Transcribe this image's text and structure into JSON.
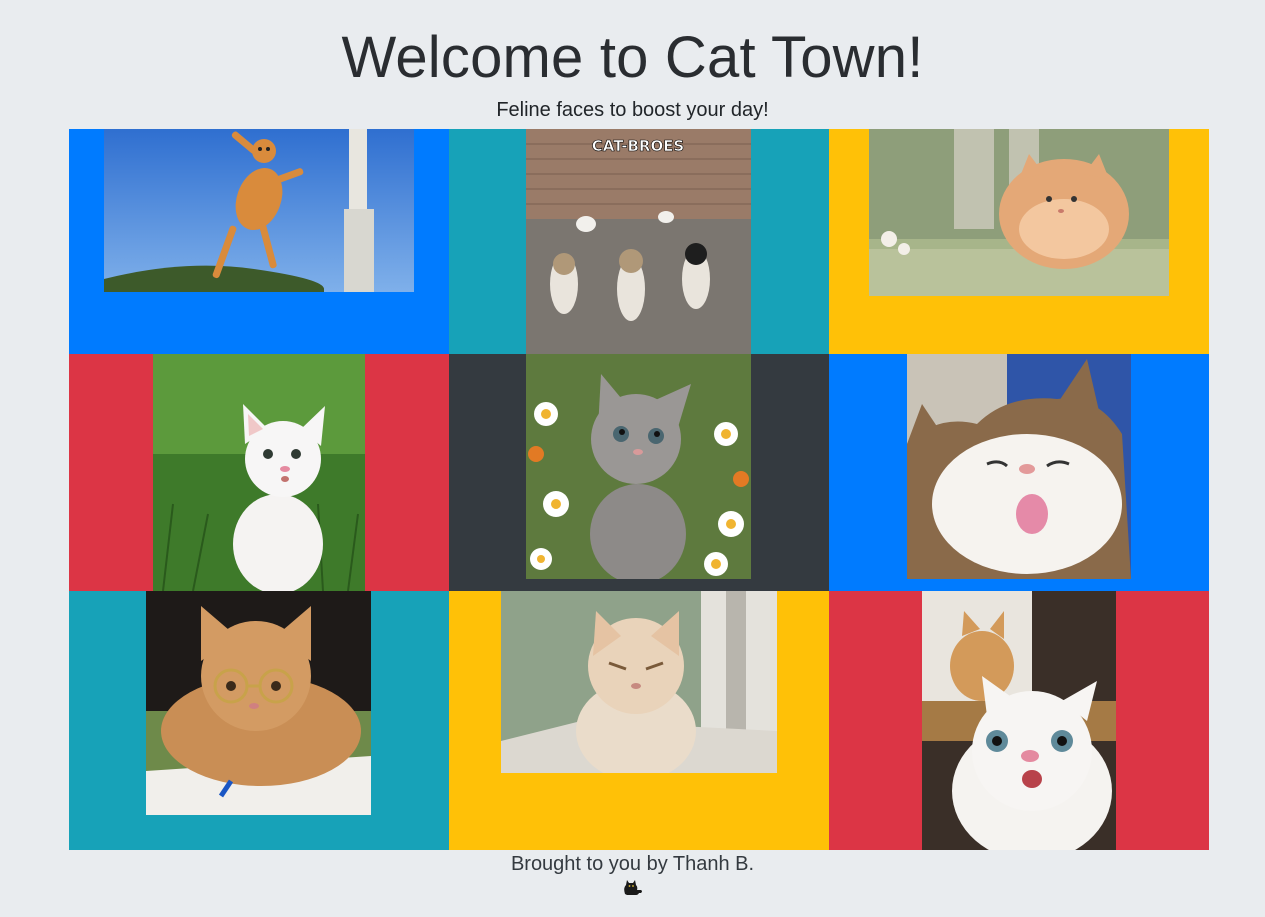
{
  "header": {
    "title": "Welcome to Cat Town!",
    "subtitle": "Feline faces to boost your day!"
  },
  "gallery": {
    "colors": {
      "blue": "#007bff",
      "teal": "#17a2b8",
      "yellow": "#ffc107",
      "red": "#dc3545",
      "dark": "#343a40"
    },
    "tiles": [
      {
        "background": "#007bff",
        "photo": "leaping orange cat against blue sky"
      },
      {
        "background": "#17a2b8",
        "photo": "three cats walking on a street",
        "caption": "CAT-BROES"
      },
      {
        "background": "#ffc107",
        "photo": "fluffy round ginger cat jumping"
      },
      {
        "background": "#dc3545",
        "photo": "white kitten sitting in grass"
      },
      {
        "background": "#343a40",
        "photo": "grey kitten among daisies"
      },
      {
        "background": "#007bff",
        "photo": "tabby and white cat with tongue out"
      },
      {
        "background": "#17a2b8",
        "photo": "ginger cat wearing round glasses with pen and notebook"
      },
      {
        "background": "#ffc107",
        "photo": "grumpy cream cat by a window"
      },
      {
        "background": "#dc3545",
        "photo": "surprised white cat selfie with ginger cat behind"
      }
    ]
  },
  "footer": {
    "credit": "Brought to you by Thanh B.",
    "icon": "black-cat-icon"
  }
}
